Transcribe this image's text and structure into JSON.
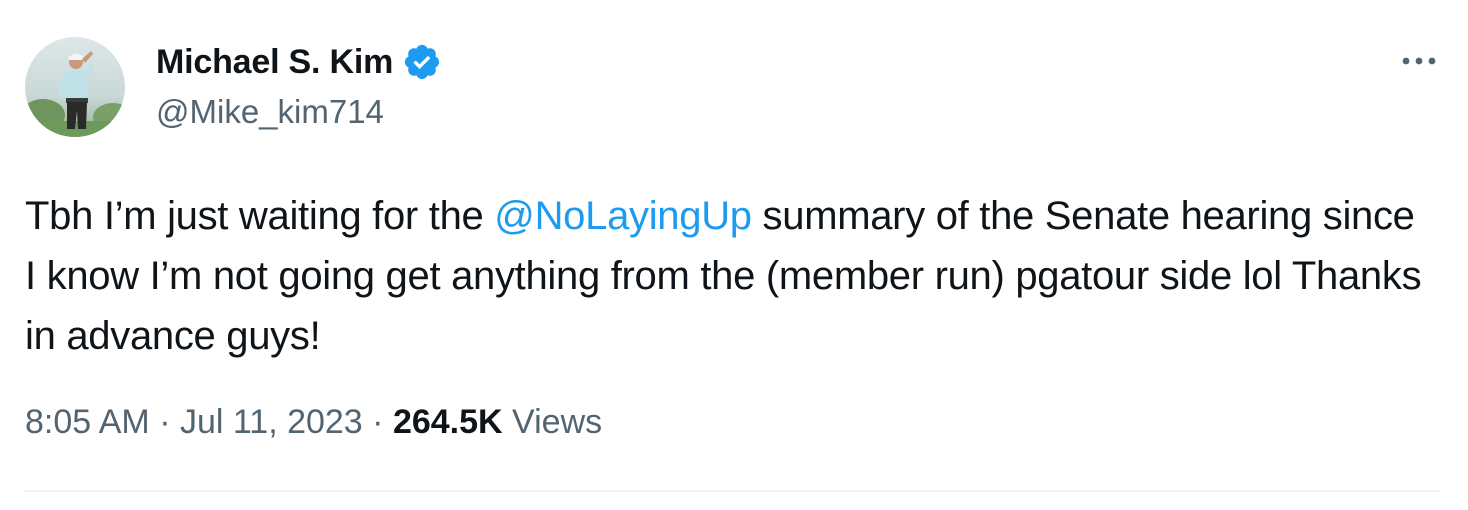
{
  "author": {
    "display_name": "Michael S. Kim",
    "handle": "@Mike_kim714",
    "verified": true
  },
  "tweet": {
    "text_before": "Tbh I’m just waiting for the ",
    "mention": "@NoLayingUp",
    "text_after": " summary of the Senate hearing since I know I’m not going get anything from the (member run) pgatour side lol Thanks in advance guys!"
  },
  "meta": {
    "time": "8:05 AM",
    "separator": "·",
    "date": "Jul 11, 2023",
    "views_count": "264.5K",
    "views_label": "Views"
  },
  "icons": {
    "verified": "verified-badge-icon",
    "more": "more-horizontal-icon"
  },
  "colors": {
    "link": "#1d9bf0",
    "secondary_text": "#536471",
    "primary_text": "#0f1419",
    "divider": "#eff3f4"
  }
}
